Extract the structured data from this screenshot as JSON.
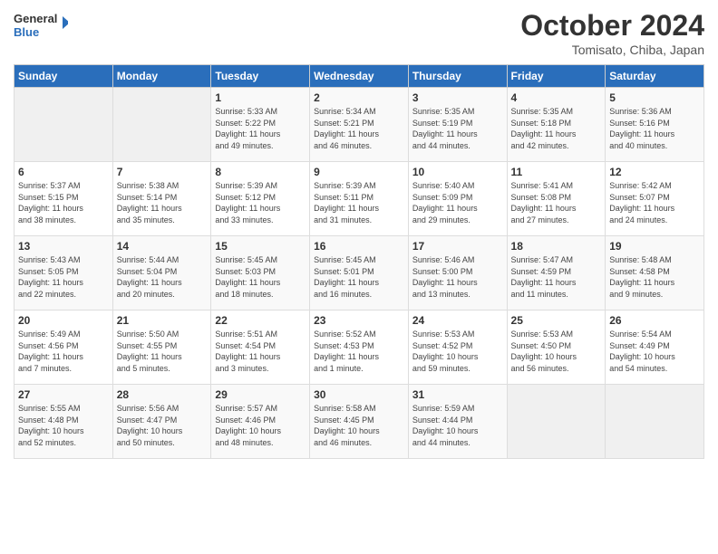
{
  "header": {
    "logo_line1": "General",
    "logo_line2": "Blue",
    "month": "October 2024",
    "location": "Tomisato, Chiba, Japan"
  },
  "weekdays": [
    "Sunday",
    "Monday",
    "Tuesday",
    "Wednesday",
    "Thursday",
    "Friday",
    "Saturday"
  ],
  "weeks": [
    [
      {
        "day": "",
        "detail": ""
      },
      {
        "day": "",
        "detail": ""
      },
      {
        "day": "1",
        "detail": "Sunrise: 5:33 AM\nSunset: 5:22 PM\nDaylight: 11 hours\nand 49 minutes."
      },
      {
        "day": "2",
        "detail": "Sunrise: 5:34 AM\nSunset: 5:21 PM\nDaylight: 11 hours\nand 46 minutes."
      },
      {
        "day": "3",
        "detail": "Sunrise: 5:35 AM\nSunset: 5:19 PM\nDaylight: 11 hours\nand 44 minutes."
      },
      {
        "day": "4",
        "detail": "Sunrise: 5:35 AM\nSunset: 5:18 PM\nDaylight: 11 hours\nand 42 minutes."
      },
      {
        "day": "5",
        "detail": "Sunrise: 5:36 AM\nSunset: 5:16 PM\nDaylight: 11 hours\nand 40 minutes."
      }
    ],
    [
      {
        "day": "6",
        "detail": "Sunrise: 5:37 AM\nSunset: 5:15 PM\nDaylight: 11 hours\nand 38 minutes."
      },
      {
        "day": "7",
        "detail": "Sunrise: 5:38 AM\nSunset: 5:14 PM\nDaylight: 11 hours\nand 35 minutes."
      },
      {
        "day": "8",
        "detail": "Sunrise: 5:39 AM\nSunset: 5:12 PM\nDaylight: 11 hours\nand 33 minutes."
      },
      {
        "day": "9",
        "detail": "Sunrise: 5:39 AM\nSunset: 5:11 PM\nDaylight: 11 hours\nand 31 minutes."
      },
      {
        "day": "10",
        "detail": "Sunrise: 5:40 AM\nSunset: 5:09 PM\nDaylight: 11 hours\nand 29 minutes."
      },
      {
        "day": "11",
        "detail": "Sunrise: 5:41 AM\nSunset: 5:08 PM\nDaylight: 11 hours\nand 27 minutes."
      },
      {
        "day": "12",
        "detail": "Sunrise: 5:42 AM\nSunset: 5:07 PM\nDaylight: 11 hours\nand 24 minutes."
      }
    ],
    [
      {
        "day": "13",
        "detail": "Sunrise: 5:43 AM\nSunset: 5:05 PM\nDaylight: 11 hours\nand 22 minutes."
      },
      {
        "day": "14",
        "detail": "Sunrise: 5:44 AM\nSunset: 5:04 PM\nDaylight: 11 hours\nand 20 minutes."
      },
      {
        "day": "15",
        "detail": "Sunrise: 5:45 AM\nSunset: 5:03 PM\nDaylight: 11 hours\nand 18 minutes."
      },
      {
        "day": "16",
        "detail": "Sunrise: 5:45 AM\nSunset: 5:01 PM\nDaylight: 11 hours\nand 16 minutes."
      },
      {
        "day": "17",
        "detail": "Sunrise: 5:46 AM\nSunset: 5:00 PM\nDaylight: 11 hours\nand 13 minutes."
      },
      {
        "day": "18",
        "detail": "Sunrise: 5:47 AM\nSunset: 4:59 PM\nDaylight: 11 hours\nand 11 minutes."
      },
      {
        "day": "19",
        "detail": "Sunrise: 5:48 AM\nSunset: 4:58 PM\nDaylight: 11 hours\nand 9 minutes."
      }
    ],
    [
      {
        "day": "20",
        "detail": "Sunrise: 5:49 AM\nSunset: 4:56 PM\nDaylight: 11 hours\nand 7 minutes."
      },
      {
        "day": "21",
        "detail": "Sunrise: 5:50 AM\nSunset: 4:55 PM\nDaylight: 11 hours\nand 5 minutes."
      },
      {
        "day": "22",
        "detail": "Sunrise: 5:51 AM\nSunset: 4:54 PM\nDaylight: 11 hours\nand 3 minutes."
      },
      {
        "day": "23",
        "detail": "Sunrise: 5:52 AM\nSunset: 4:53 PM\nDaylight: 11 hours\nand 1 minute."
      },
      {
        "day": "24",
        "detail": "Sunrise: 5:53 AM\nSunset: 4:52 PM\nDaylight: 10 hours\nand 59 minutes."
      },
      {
        "day": "25",
        "detail": "Sunrise: 5:53 AM\nSunset: 4:50 PM\nDaylight: 10 hours\nand 56 minutes."
      },
      {
        "day": "26",
        "detail": "Sunrise: 5:54 AM\nSunset: 4:49 PM\nDaylight: 10 hours\nand 54 minutes."
      }
    ],
    [
      {
        "day": "27",
        "detail": "Sunrise: 5:55 AM\nSunset: 4:48 PM\nDaylight: 10 hours\nand 52 minutes."
      },
      {
        "day": "28",
        "detail": "Sunrise: 5:56 AM\nSunset: 4:47 PM\nDaylight: 10 hours\nand 50 minutes."
      },
      {
        "day": "29",
        "detail": "Sunrise: 5:57 AM\nSunset: 4:46 PM\nDaylight: 10 hours\nand 48 minutes."
      },
      {
        "day": "30",
        "detail": "Sunrise: 5:58 AM\nSunset: 4:45 PM\nDaylight: 10 hours\nand 46 minutes."
      },
      {
        "day": "31",
        "detail": "Sunrise: 5:59 AM\nSunset: 4:44 PM\nDaylight: 10 hours\nand 44 minutes."
      },
      {
        "day": "",
        "detail": ""
      },
      {
        "day": "",
        "detail": ""
      }
    ]
  ]
}
